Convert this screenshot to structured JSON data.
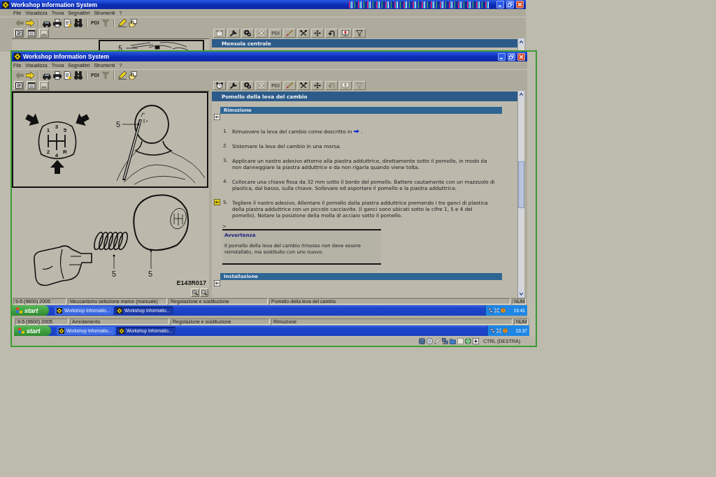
{
  "back_window": {
    "title": "Workshop Information System",
    "menu": [
      "File",
      "Visualizza",
      "Trova",
      "Segnalibri",
      "Strumenti",
      "?"
    ],
    "toolbar": [
      {
        "kind": "back",
        "disabled": true
      },
      {
        "kind": "forward",
        "disabled": false
      },
      {
        "kind": "car",
        "disabled": false
      },
      {
        "kind": "print",
        "disabled": false
      },
      {
        "kind": "document",
        "disabled": false
      },
      {
        "kind": "binoculars",
        "disabled": false
      },
      {
        "kind": "text",
        "label": "PDI",
        "disabled": false
      },
      {
        "kind": "filter",
        "disabled": true
      },
      {
        "kind": "pencil",
        "disabled": false
      },
      {
        "kind": "hand",
        "disabled": false
      }
    ],
    "view_buttons": [
      {
        "kind": "index",
        "disabled": false
      },
      {
        "kind": "list",
        "disabled": false
      },
      {
        "kind": "image",
        "disabled": true
      }
    ],
    "tabs": [
      {
        "kind": "clock",
        "disabled": true
      },
      {
        "kind": "wrench",
        "disabled": false
      },
      {
        "kind": "gears",
        "disabled": false
      },
      {
        "kind": "gear-page",
        "disabled": true
      },
      {
        "kind": "text",
        "label": "PDI",
        "disabled": true
      },
      {
        "kind": "brush",
        "disabled": false
      },
      {
        "kind": "tools",
        "disabled": false
      },
      {
        "kind": "move",
        "disabled": false
      },
      {
        "kind": "return",
        "disabled": false
      },
      {
        "kind": "board",
        "disabled": false
      },
      {
        "kind": "funnel",
        "disabled": false
      }
    ],
    "figure_callout": "5",
    "page_title": "Mensola centrale"
  },
  "front_window": {
    "title": "Workshop Information System",
    "menu": [
      "File",
      "Visualizza",
      "Trova",
      "Segnalibri",
      "Strumenti",
      "?"
    ],
    "toolbar": [
      {
        "kind": "back",
        "disabled": true
      },
      {
        "kind": "forward",
        "disabled": false
      },
      {
        "kind": "car",
        "disabled": false
      },
      {
        "kind": "print",
        "disabled": false
      },
      {
        "kind": "document",
        "disabled": false
      },
      {
        "kind": "binoculars",
        "disabled": false
      },
      {
        "kind": "text",
        "label": "PDI",
        "disabled": false
      },
      {
        "kind": "filter",
        "disabled": true
      },
      {
        "kind": "pencil",
        "disabled": false
      },
      {
        "kind": "hand",
        "disabled": false
      }
    ],
    "view_buttons": [
      {
        "kind": "index",
        "disabled": false
      },
      {
        "kind": "list",
        "disabled": false
      },
      {
        "kind": "image",
        "disabled": true
      }
    ],
    "tabs": [
      {
        "kind": "clock",
        "disabled": false
      },
      {
        "kind": "wrench",
        "disabled": false
      },
      {
        "kind": "gears",
        "disabled": false
      },
      {
        "kind": "gear-page",
        "disabled": true
      },
      {
        "kind": "text",
        "label": "PDI",
        "disabled": true
      },
      {
        "kind": "brush",
        "disabled": false
      },
      {
        "kind": "tools",
        "disabled": false
      },
      {
        "kind": "move",
        "disabled": false
      },
      {
        "kind": "return",
        "disabled": true
      },
      {
        "kind": "board",
        "disabled": true
      },
      {
        "kind": "funnel",
        "disabled": true
      }
    ],
    "figure": {
      "gear_positions": [
        "1",
        "3",
        "5",
        "2",
        "4",
        "R"
      ],
      "callouts": [
        "5",
        "5",
        "5"
      ],
      "code": "E143R017"
    },
    "page_title": "Pomello della leva del cambio",
    "sections": [
      {
        "title": "Rimozione",
        "steps": [
          {
            "number": "1.",
            "text": "Rimuovere la leva del cambio come descritto in",
            "link": true,
            "text_after": ".",
            "marker": false
          },
          {
            "number": "2.",
            "text": "Sistemare la leva del cambio in una morsa.",
            "link": false,
            "marker": false
          },
          {
            "number": "3.",
            "text": "Applicare un nastro adesivo attorno alla piastra adduttrice, direttamente sotto il pomello, in modo da non danneggiare la piastra adduttrice e da non rigarla quando viene tolta.",
            "link": false,
            "marker": false
          },
          {
            "number": "4.",
            "text": "Collocare una chiave fissa da 32 mm sotto il bordo del pomello. Battere cautamente con un mazzuolo di plastica, dal basso, sulla chiave. Sollevare ed asportare il pomello e la piastra adduttrice.",
            "link": false,
            "marker": false
          },
          {
            "number": "5.",
            "text": "Togliere il nastro adesivo. Allentare il pomello dalla piastra adduttrice premendo i tre ganci di plastica della piastra adduttrice con un piccolo cacciavite. (I ganci sono ubicati sotto le cifre 1, 5 e 4 del pomello). Notare la posizione della molla di acciaio sotto il pomello.",
            "link": false,
            "marker": true
          }
        ],
        "note": {
          "marker": ">",
          "title": "Avvertenza",
          "text": "Il pomello della leva del cambio rimosso non deve essere reinstallato, ma sostituito con uno nuovo."
        }
      },
      {
        "title": "Installazione"
      }
    ],
    "status_bar": [
      "9-5 (9600) 2005",
      "Meccanismo selezione marce (manuale)",
      "Regolazione e sostituzione",
      "Pomello della leva del cambio",
      "NUM"
    ]
  },
  "front_taskbar": {
    "start": "start",
    "tasks": [
      {
        "label": "Workshop Informatio...",
        "selected": false
      },
      {
        "label": "Workshop Informatio...",
        "selected": true
      }
    ],
    "clock": "19.41"
  },
  "back_status_bar": [
    "9-5 (9600) 2005",
    "Arredamento",
    "Regolazione e sostituzione",
    "Rimozione",
    "NUM"
  ],
  "back_taskbar": {
    "start": "start",
    "tasks": [
      {
        "label": "Workshop Informatio...",
        "selected": false
      },
      {
        "label": "Workshop Informatio...",
        "selected": true
      }
    ],
    "clock": "19.37"
  },
  "vm_status_bar": {
    "indicators": [
      {
        "kind": "disk"
      },
      {
        "kind": "cd"
      },
      {
        "kind": "pen"
      },
      {
        "kind": "network"
      },
      {
        "kind": "folder"
      },
      {
        "kind": "blank"
      },
      {
        "kind": "globe"
      },
      {
        "kind": "arrow"
      }
    ],
    "host_key": "CTRL (DESTRA)"
  }
}
